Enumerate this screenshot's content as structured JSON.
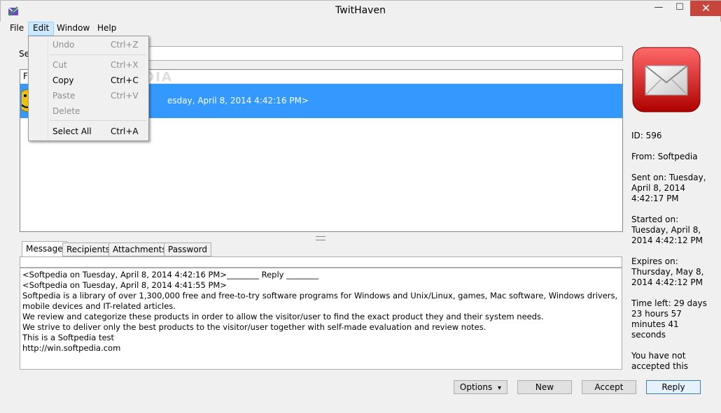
{
  "window": {
    "title": "TwitHaven",
    "minimize": "—",
    "maximize": "☐",
    "close": "✕"
  },
  "menu": {
    "file": "File",
    "edit": "Edit",
    "window": "Window",
    "help": "Help"
  },
  "edit_menu": {
    "undo": {
      "label": "Undo",
      "shortcut": "Ctrl+Z",
      "enabled": false
    },
    "cut": {
      "label": "Cut",
      "shortcut": "Ctrl+X",
      "enabled": false
    },
    "copy": {
      "label": "Copy",
      "shortcut": "Ctrl+C",
      "enabled": true
    },
    "paste": {
      "label": "Paste",
      "shortcut": "Ctrl+V",
      "enabled": false
    },
    "delete": {
      "label": "Delete",
      "shortcut": "",
      "enabled": false
    },
    "select_all": {
      "label": "Select All",
      "shortcut": "Ctrl+A",
      "enabled": true
    }
  },
  "search": {
    "label": "Se",
    "value": ""
  },
  "message_list": {
    "header": "F",
    "rows": [
      {
        "text": "esday, April 8, 2014 4:42:16 PM>",
        "selected": true
      }
    ]
  },
  "tabs": [
    "Message",
    "Recipients",
    "Attachments",
    "Password"
  ],
  "message": {
    "lines": [
      "<Softpedia on Tuesday, April 8, 2014 4:42:16 PM>________ Reply ________",
      "<Softpedia on Tuesday, April 8, 2014 4:41:55 PM>",
      "Softpedia is a library of over 1,300,000 free and free-to-try software programs for Windows and Unix/Linux, games, Mac software, Windows drivers, mobile devices and IT-related articles.",
      "We review and categorize these products in order to allow the visitor/user to find the exact product they and their system needs.",
      "We strive to deliver only the best products to the visitor/user together with self-made evaluation and review notes.",
      "This is a Softpedia test",
      "http://win.softpedia.com"
    ]
  },
  "details": {
    "id": "ID: 596",
    "from": "From: Softpedia",
    "sent": "Sent on: Tuesday, April 8, 2014 4:42:17 PM",
    "started": "Started on: Tuesday, April 8, 2014 4:42:12 PM",
    "expires": "Expires on: Thursday, May 8, 2014 4:42:12 PM",
    "time_left": "Time left: 29 days 23 hours 57 minutes 41 seconds",
    "status": "You have not accepted this"
  },
  "buttons": {
    "options": "Options",
    "options_arrow": "▾",
    "new": "New",
    "accept": "Accept",
    "reply": "Reply"
  },
  "watermark": "SOFTPEDIA",
  "colors": {
    "selection": "#3399ff",
    "menu_highlight": "#cce8ff",
    "close_button": "#c7453a"
  }
}
